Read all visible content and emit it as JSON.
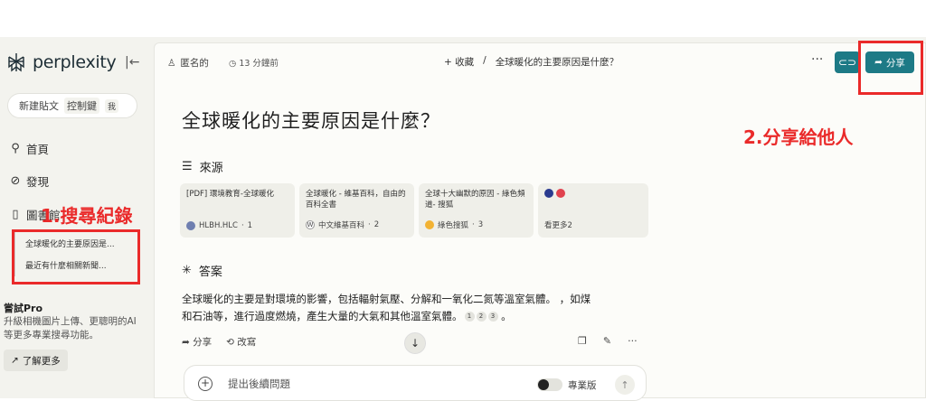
{
  "sidebar": {
    "brand": "perplexity",
    "collapse_icon": "sidebar-collapse-icon",
    "new_thread": {
      "label": "新建貼文",
      "kbd1": "控制鍵",
      "kbd2": "我"
    },
    "nav": [
      {
        "label": "首頁",
        "icon": "search-icon"
      },
      {
        "label": "發現",
        "icon": "compass-icon"
      },
      {
        "label": "圖書館",
        "icon": "library-icon"
      }
    ],
    "history": [
      "全球暖化的主要原因是...",
      "最近有什麼相關新聞..."
    ],
    "pro": {
      "title": "嘗試Pro",
      "desc": "升級相機圖片上傳、更聰明的AI等更多專業搜尋功能。",
      "learn_more": "了解更多"
    }
  },
  "topbar": {
    "anon": "匿名的",
    "time": "13 分鐘前",
    "bookmark": "+ 收藏",
    "separator": "/",
    "crumb_title": "全球暖化的主要原因是什麼？",
    "more": "···",
    "share": "分享"
  },
  "main": {
    "title": "全球暖化的主要原因是什麼？",
    "sources_heading": "來源",
    "sources": [
      {
        "title": "[PDF] 環境教育-全球暖化",
        "site": "HLBH.HLC",
        "num": "1"
      },
      {
        "title": "全球暖化 - 維基百科，自由的百科全書",
        "site": "中文維基百科",
        "num": "2"
      },
      {
        "title": "全球十大幽默的原因 - 綠色頻道- 搜狐",
        "site": "綠色搜狐",
        "num": "3"
      }
    ],
    "see_more": "看更多2",
    "answer_heading": "答案",
    "answer_line1": "全球暖化的主要是對環境的影響，包括輻射氣壓、分解和一氧化二氮等溫室氣體。 ，如煤",
    "answer_line2": "和石油等，進行過度燃燒，產生大量的大氣和其他溫室氣體。",
    "citations": [
      "1",
      "2",
      "3"
    ],
    "actions": {
      "share": "分享",
      "rewrite": "改寫"
    },
    "followup_placeholder": "提出後續問題",
    "pro_label": "專業版"
  },
  "annotations": {
    "label1": "1.搜尋紀錄",
    "label2": "2.分享給他人",
    "color": "#ea2a2a"
  },
  "colors": {
    "accent": "#1d7a86",
    "sidebar_bg": "#f3f3ee",
    "main_bg": "#fcfcf9"
  }
}
